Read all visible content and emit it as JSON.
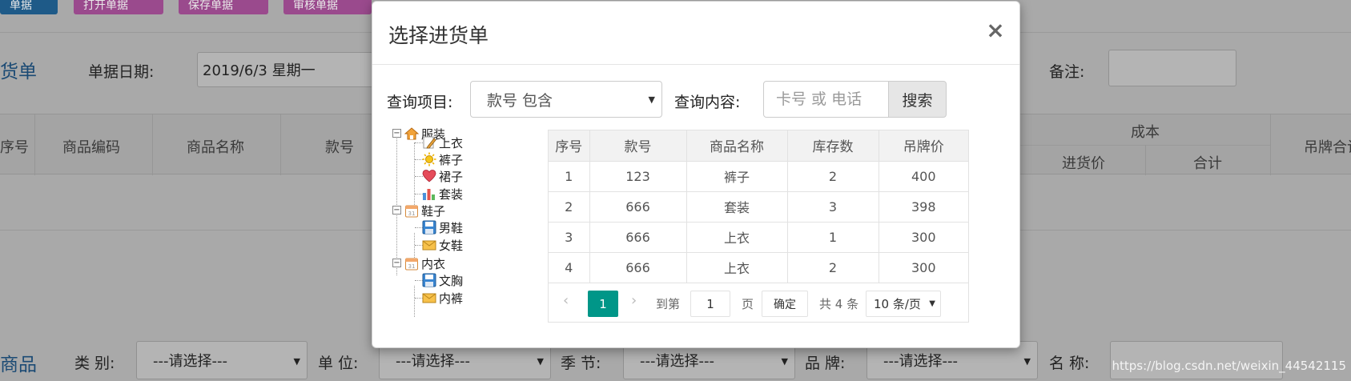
{
  "background": {
    "toolbar": [
      {
        "label": "单据",
        "color": "#1e5a88"
      },
      {
        "label": "打开单据",
        "color": "#9a4a8d"
      },
      {
        "label": "保存单据",
        "color": "#9a4a8d"
      },
      {
        "label": "审核单据",
        "color": "#9a4a8d"
      }
    ],
    "form_title": "货单",
    "date_label": "单据日期:",
    "date_value": "2019/6/3 星期一",
    "remark_label": "备注:",
    "columns": [
      "序号",
      "商品编码",
      "商品名称",
      "款号"
    ],
    "cost_group": "成本",
    "cost_cols": [
      "进货价",
      "合计"
    ],
    "tag_price_col": "吊牌合计",
    "bottom_title": "商品",
    "filters": [
      {
        "label": "类 别:",
        "value": "---请选择---"
      },
      {
        "label": "单 位:",
        "value": "---请选择---"
      },
      {
        "label": "季 节:",
        "value": "---请选择---"
      },
      {
        "label": "品 牌:",
        "value": "---请选择---"
      }
    ],
    "name_label": "名 称:",
    "watermark": "https://blog.csdn.net/weixin_44542115"
  },
  "modal": {
    "title": "选择进货单",
    "close": "×",
    "query_item_label": "查询项目:",
    "query_item_value": "款号 包含",
    "query_content_label": "查询内容:",
    "query_placeholder": "卡号 或 电话",
    "search_button": "搜索",
    "tree": [
      {
        "label": "服装",
        "children": [
          "上衣",
          "裤子",
          "裙子",
          "套装"
        ]
      },
      {
        "label": "鞋子",
        "children": [
          "男鞋",
          "女鞋"
        ]
      },
      {
        "label": "内衣",
        "children": [
          "文胸",
          "内裤"
        ]
      }
    ],
    "table": {
      "headers": [
        "序号",
        "款号",
        "商品名称",
        "库存数",
        "吊牌价"
      ],
      "rows": [
        [
          "1",
          "123",
          "裤子",
          "2",
          "400"
        ],
        [
          "2",
          "666",
          "套装",
          "3",
          "398"
        ],
        [
          "3",
          "666",
          "上衣",
          "1",
          "300"
        ],
        [
          "4",
          "666",
          "上衣",
          "2",
          "300"
        ]
      ]
    },
    "pager": {
      "prev": "‹",
      "current": "1",
      "next": "›",
      "goto_label": "到第",
      "goto_value": "1",
      "page_unit": "页",
      "confirm": "确定",
      "total": "共 4 条",
      "page_size": "10 条/页"
    }
  }
}
